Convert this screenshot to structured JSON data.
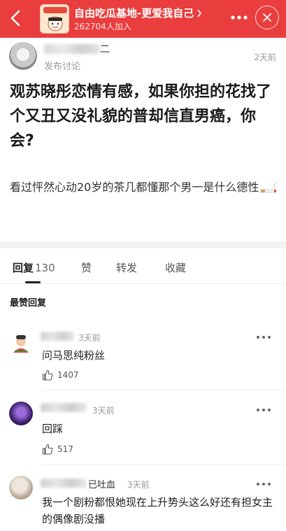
{
  "header": {
    "group_name": "自由吃瓜基地-更爱我自己",
    "member_count": "262704人加入",
    "brand_color": "#ea3d3d",
    "back_icon": "chevron-left-icon",
    "more_icon": "ellipsis-icon",
    "close_icon": "close-icon"
  },
  "post": {
    "author_name_visible": "二",
    "subtitle": "发布讨论",
    "time": "2天前",
    "title": "观苏晓彤恋情有感，如果你担的花找了个又丑又没礼貌的普却信直男癌，你会?",
    "body": "看过怦然心动20岁的茶几都懂那个男一是什么德性"
  },
  "tabs": [
    {
      "label": "回复",
      "count": "130"
    },
    {
      "label": "赞"
    },
    {
      "label": "转发"
    },
    {
      "label": "收藏"
    }
  ],
  "section_label": "最赞回复",
  "comments": [
    {
      "name_visible": "",
      "time": "3天前",
      "text": "问马思纯粉丝",
      "likes": "1407"
    },
    {
      "name_visible": "",
      "time": "3天前",
      "text": "回踩",
      "likes": "517"
    },
    {
      "name_visible": "已吐血",
      "time": "3天前",
      "text": "我一个剧粉都恨她现在上升势头这么好还有担女主的偶像剧没播",
      "likes": ""
    }
  ]
}
